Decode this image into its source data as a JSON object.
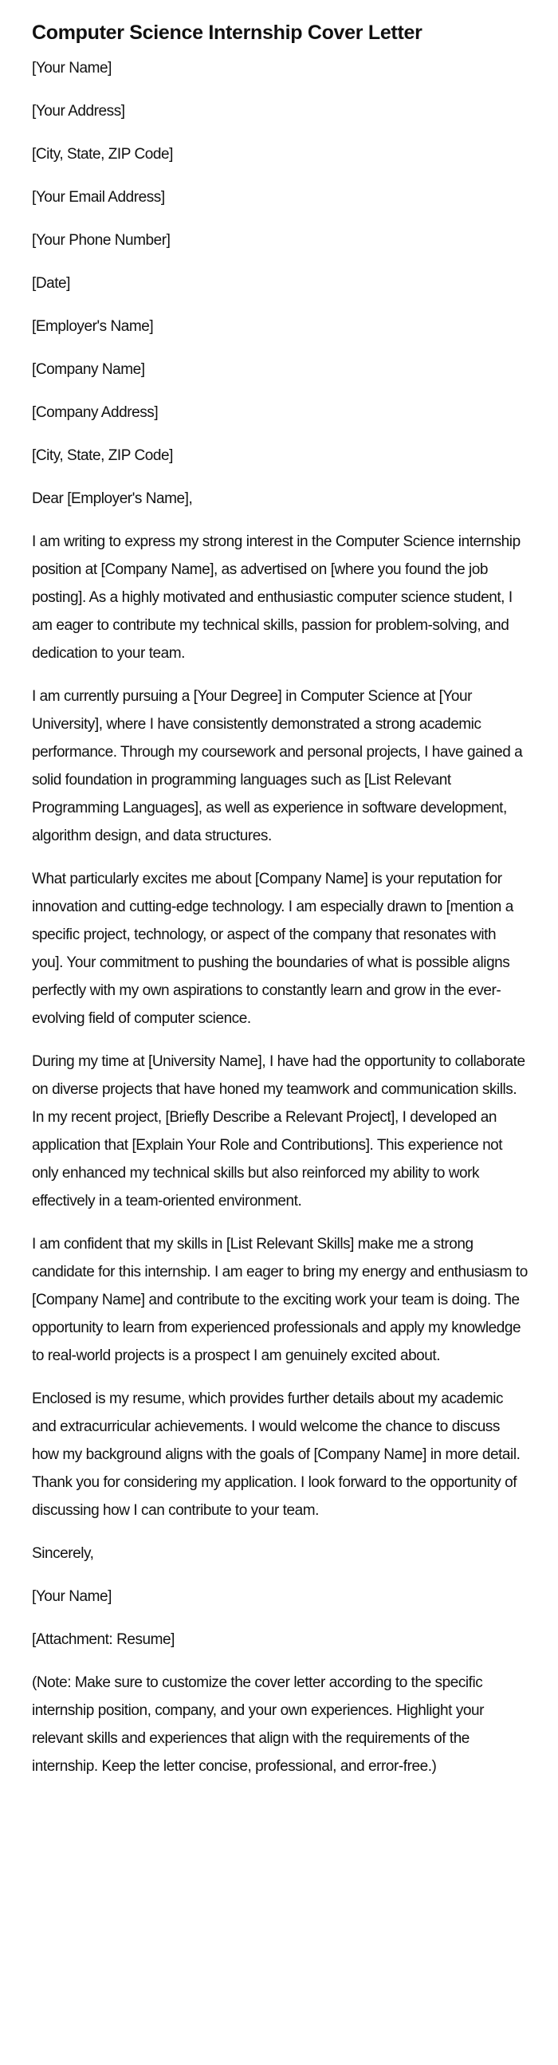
{
  "title": "Computer Science Internship Cover Letter",
  "sender": [
    "[Your Name]",
    "[Your Address]",
    "[City, State, ZIP Code]",
    "[Your Email Address]",
    "[Your Phone Number]"
  ],
  "date": "[Date]",
  "recipient": [
    "[Employer's Name]",
    "[Company Name]",
    "[Company Address]",
    "[City, State, ZIP Code]"
  ],
  "salutation": "Dear [Employer's Name],",
  "paragraphs": [
    "I am writing to express my strong interest in the Computer Science internship position at [Company Name], as advertised on [where you found the job posting]. As a highly motivated and enthusiastic computer science student, I am eager to contribute my technical skills, passion for problem-solving, and dedication to your team.",
    "I am currently pursuing a [Your Degree] in Computer Science at [Your University], where I have consistently demonstrated a strong academic performance. Through my coursework and personal projects, I have gained a solid foundation in programming languages such as [List Relevant Programming Languages], as well as experience in software development, algorithm design, and data structures.",
    "What particularly excites me about [Company Name] is your reputation for innovation and cutting-edge technology. I am especially drawn to [mention a specific project, technology, or aspect of the company that resonates with you]. Your commitment to pushing the boundaries of what is possible aligns perfectly with my own aspirations to constantly learn and grow in the ever-evolving field of computer science.",
    "During my time at [University Name], I have had the opportunity to collaborate on diverse projects that have honed my teamwork and communication skills. In my recent project, [Briefly Describe a Relevant Project], I developed an application that [Explain Your Role and Contributions]. This experience not only enhanced my technical skills but also reinforced my ability to work effectively in a team-oriented environment.",
    "I am confident that my skills in [List Relevant Skills] make me a strong candidate for this internship. I am eager to bring my energy and enthusiasm to [Company Name] and contribute to the exciting work your team is doing. The opportunity to learn from experienced professionals and apply my knowledge to real-world projects is a prospect I am genuinely excited about.",
    "Enclosed is my resume, which provides further details about my academic and extracurricular achievements. I would welcome the chance to discuss how my background aligns with the goals of [Company Name] in more detail. Thank you for considering my application. I look forward to the opportunity of discussing how I can contribute to your team."
  ],
  "closing": "Sincerely,",
  "signature": "[Your Name]",
  "attachment": "[Attachment: Resume]",
  "note": "(Note: Make sure to customize the cover letter according to the specific internship position, company, and your own experiences. Highlight your relevant skills and experiences that align with the requirements of the internship. Keep the letter concise, professional, and error-free.)"
}
